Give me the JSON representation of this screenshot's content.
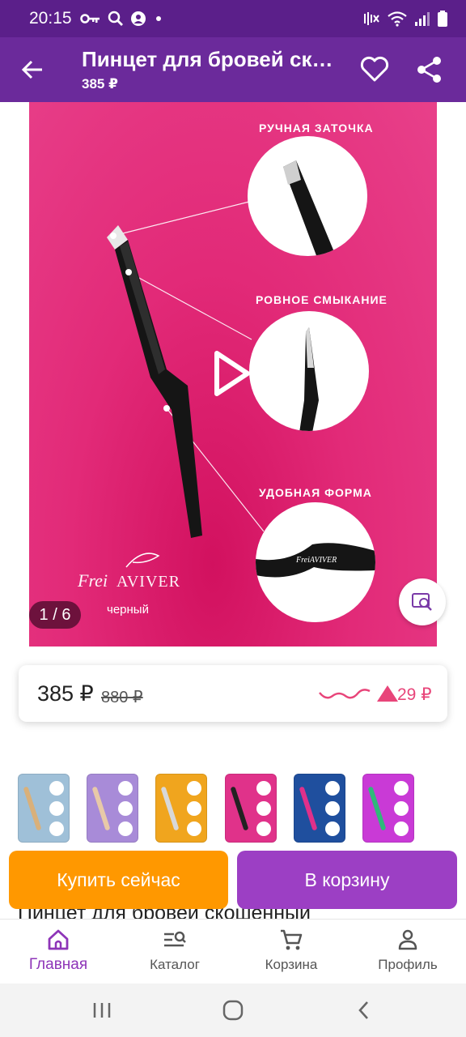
{
  "status_bar": {
    "time": "20:15",
    "left_icons": [
      "key-icon",
      "search-icon",
      "account-circle-icon",
      "dot-icon"
    ],
    "right_icons": [
      "mute-icon",
      "wifi-icon",
      "signal-icon",
      "battery-icon"
    ]
  },
  "app_bar": {
    "title": "Пинцет для бровей ск…",
    "subtitle": "385 ₽",
    "background": "#6b2a9b"
  },
  "product_image": {
    "features": [
      "РУЧНАЯ ЗАТОЧКА",
      "РОВНОЕ СМЫКАНИЕ",
      "УДОБНАЯ ФОРМА"
    ],
    "brand": "FreiAVIVER",
    "color_label": "черный",
    "counter": "1 / 6",
    "background": "#e22a78"
  },
  "price_card": {
    "price": "385 ₽",
    "old_price": "880 ₽",
    "change": "29 ₽",
    "accent": "#e8457a"
  },
  "thumbnails": [
    {
      "bg": "#9fc0d8",
      "tool": "#d9b07a"
    },
    {
      "bg": "#a88bd8",
      "tool": "#e8c9a8"
    },
    {
      "bg": "#f0a51e",
      "tool": "#d8d8d8"
    },
    {
      "bg": "#e0328a",
      "tool": "#222222"
    },
    {
      "bg": "#1f4f9e",
      "tool": "#e0308a"
    },
    {
      "bg": "#c93ad6",
      "tool": "#2fb87a"
    }
  ],
  "actions": {
    "buy_now": "Купить сейчас",
    "add_to_cart": "В корзину",
    "buy_color": "#ff9800",
    "cart_color": "#9c3fc4"
  },
  "product_title_cut": "Пинцет для бровей скошенный",
  "bottom_nav": {
    "items": [
      {
        "label": "Главная",
        "icon": "home-icon",
        "active": true
      },
      {
        "label": "Каталог",
        "icon": "catalog-search-icon",
        "active": false
      },
      {
        "label": "Корзина",
        "icon": "cart-icon",
        "active": false
      },
      {
        "label": "Профиль",
        "icon": "person-icon",
        "active": false
      }
    ],
    "active_color": "#8e35b8"
  },
  "system_nav": [
    "recents-icon",
    "home-circle-icon",
    "back-chevron-icon"
  ]
}
